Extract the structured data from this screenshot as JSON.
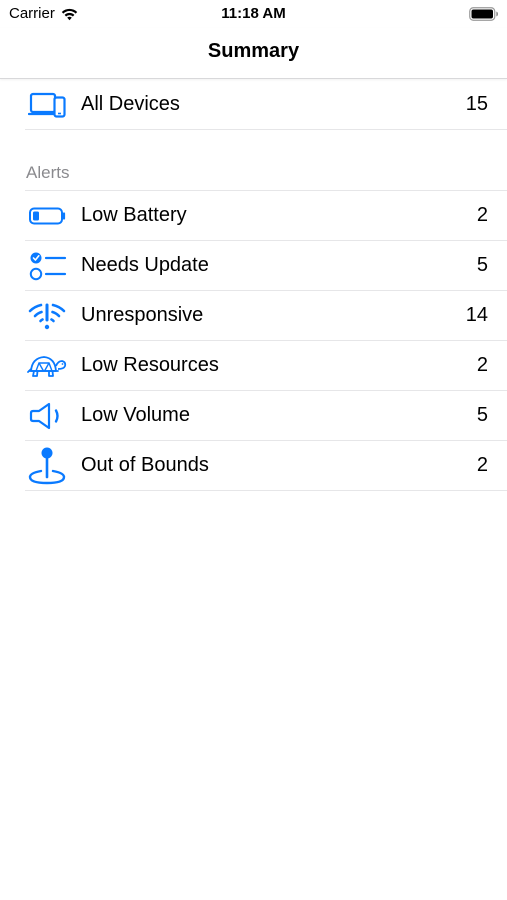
{
  "status_bar": {
    "carrier": "Carrier",
    "time": "11:18 AM"
  },
  "nav": {
    "title": "Summary"
  },
  "all_devices": {
    "icon": "devices-icon",
    "label": "All Devices",
    "count": "15"
  },
  "alerts": {
    "header": "Alerts",
    "items": [
      {
        "icon": "battery-low-icon",
        "label": "Low Battery",
        "count": "2"
      },
      {
        "icon": "checklist-icon",
        "label": "Needs Update",
        "count": "5"
      },
      {
        "icon": "wifi-exclamation-icon",
        "label": "Unresponsive",
        "count": "14"
      },
      {
        "icon": "tortoise-icon",
        "label": "Low Resources",
        "count": "2"
      },
      {
        "icon": "speaker-low-icon",
        "label": "Low Volume",
        "count": "5"
      },
      {
        "icon": "location-pin-icon",
        "label": "Out of Bounds",
        "count": "2"
      }
    ]
  },
  "colors": {
    "accent": "#0a7aff",
    "secondary_text": "#8a8a8e",
    "separator": "#e6e6e8"
  }
}
